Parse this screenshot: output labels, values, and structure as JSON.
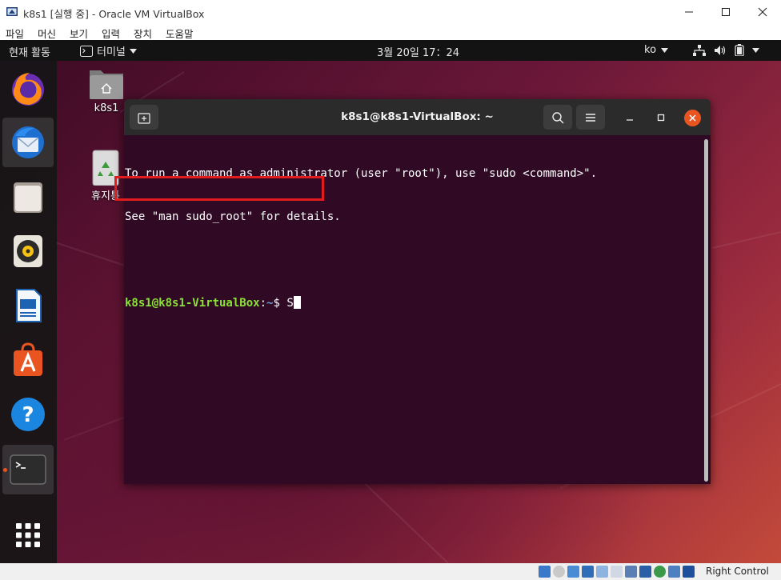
{
  "window": {
    "title": "k8s1 [실행 중] - Oracle VM VirtualBox",
    "menu": [
      "파일",
      "머신",
      "보기",
      "입력",
      "장치",
      "도움말"
    ]
  },
  "topbar": {
    "activities": "현재 활동",
    "app_name": "터미널",
    "clock": "3월 20일  17：24",
    "language": "ko",
    "tray_icons": [
      "network-icon",
      "volume-icon",
      "battery-icon",
      "chevron-down-icon"
    ]
  },
  "dock": {
    "apps": [
      "Firefox",
      "Thunderbird",
      "Files",
      "Rhythmbox",
      "LibreOffice Writer",
      "Ubuntu Software",
      "Help",
      "Terminal"
    ],
    "active_app": "Terminal",
    "show_apps_icon": "app-grid-icon"
  },
  "desktop": {
    "icons": [
      {
        "label": "k8s1",
        "icon": "home-folder-icon"
      },
      {
        "label": "휴지통",
        "icon": "trash-icon"
      }
    ]
  },
  "terminal": {
    "title": "k8s1@k8s1-VirtualBox: ~",
    "lines": [
      "To run a command as administrator (user \"root\"), use \"sudo <command>\".",
      "See \"man sudo_root\" for details."
    ],
    "prompt": {
      "user_host": "k8s1@k8s1-VirtualBox",
      "sep": ":",
      "path": "~",
      "symbol": "$ ",
      "input": "S"
    }
  },
  "statusbar": {
    "host_key": "Right Control"
  },
  "colors": {
    "ubuntu_orange": "#e95420",
    "terminal_bg": "#300a24",
    "prompt_user": "#8ae234",
    "prompt_path": "#729fcf",
    "annotation_red": "#e01c1c"
  }
}
